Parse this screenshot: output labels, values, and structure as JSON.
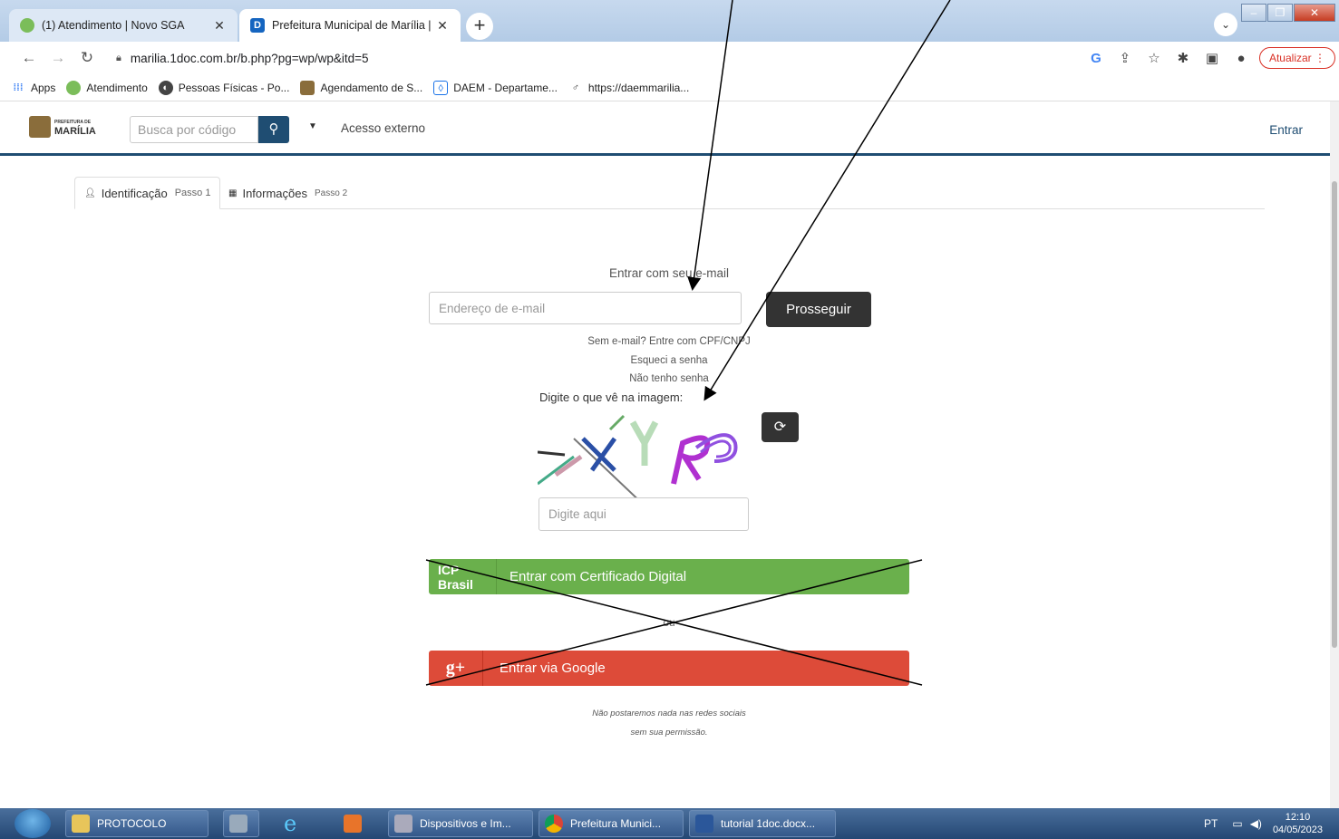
{
  "browser": {
    "tabs": [
      {
        "title": "(1) Atendimento | Novo SGA",
        "favicon": "sga-icon",
        "active": false
      },
      {
        "title": "Prefeitura Municipal de Marília |",
        "favicon": "1doc-icon",
        "favicon_letter": "D",
        "active": true
      }
    ],
    "new_tab_symbol": "+",
    "close_symbol": "✕",
    "url": "marilia.1doc.com.br/b.php?pg=wp/wp&itd=5",
    "update_label": "Atualizar",
    "bookmarks": [
      {
        "label": "Apps",
        "icon": "apps-grid-icon"
      },
      {
        "label": "Atendimento",
        "icon": "sga-icon"
      },
      {
        "label": "Pessoas Físicas - Po...",
        "icon": "globe-icon"
      },
      {
        "label": "Agendamento de S...",
        "icon": "crest-icon"
      },
      {
        "label": "DAEM - Departame...",
        "icon": "drop-icon"
      },
      {
        "label": "https://daemmarilia...",
        "icon": "leaf-icon"
      }
    ]
  },
  "site": {
    "logo_small": "PREFEITURA DE",
    "logo_big": "MARÍLIA",
    "search_placeholder": "Busca por código",
    "external_access": "Acesso externo",
    "login_link": "Entrar"
  },
  "steps": [
    {
      "label": "Identificação",
      "step": "Passo 1",
      "icon": "user-icon",
      "active": true
    },
    {
      "label": "Informações",
      "step": "Passo 2",
      "icon": "grid-icon",
      "active": false
    }
  ],
  "login": {
    "title": "Entrar com seu e-mail",
    "email_placeholder": "Endereço de e-mail",
    "proceed_label": "Prosseguir",
    "no_email_link": "Sem e-mail? Entre com CPF/CNPJ",
    "forgot_link": "Esqueci a senha",
    "no_password_link": "Não tenho senha",
    "captcha_label": "Digite o que vê na imagem:",
    "captcha_placeholder": "Digite aqui",
    "cert_icon_text": "ICP Brasil",
    "cert_label": "Entrar com Certificado Digital",
    "or_text": "ou",
    "google_icon_text": "g+",
    "google_label": "Entrar via Google",
    "social_note_line1": "Não postaremos nada nas redes sociais",
    "social_note_line2": "sem sua permissão."
  },
  "taskbar": {
    "items": [
      {
        "label": "PROTOCOLO",
        "icon": "folder-icon"
      },
      {
        "label": "",
        "icon": "calculator-icon"
      },
      {
        "label": "",
        "icon": "internet-explorer-icon"
      },
      {
        "label": "",
        "icon": "media-player-icon"
      },
      {
        "label": "Dispositivos e Im...",
        "icon": "devices-icon"
      },
      {
        "label": "Prefeitura Munici...",
        "icon": "chrome-icon"
      },
      {
        "label": "tutorial 1doc.docx...",
        "icon": "word-icon"
      }
    ],
    "lang": "PT",
    "time": "12:10",
    "date": "04/05/2023"
  },
  "colors": {
    "navy": "#1f4d72",
    "cert_green": "#6ab04c",
    "google_red": "#dd4b39",
    "dark_button": "#333333"
  }
}
